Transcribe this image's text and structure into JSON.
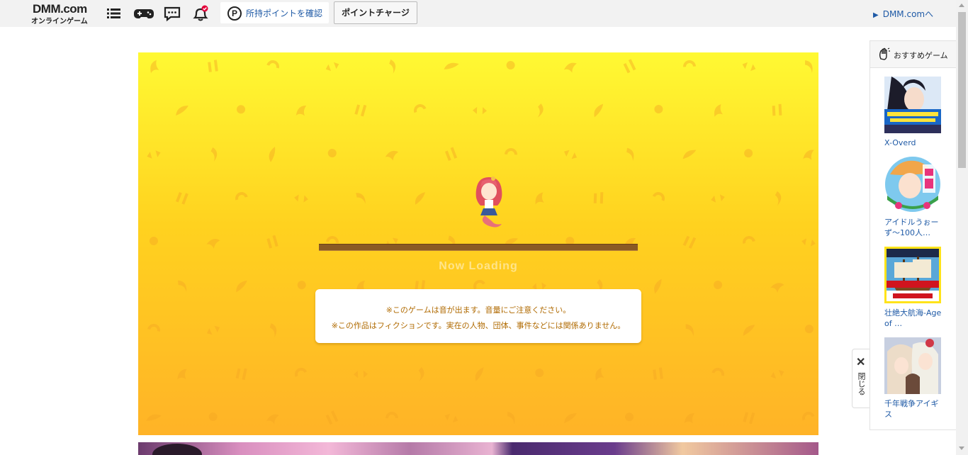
{
  "header": {
    "logo_main": "DMM.com",
    "logo_sub": "オンラインゲーム",
    "icons": [
      "list-icon",
      "gamepad-icon",
      "chat-icon",
      "bell-icon"
    ],
    "points_button": "所持ポイントを確認",
    "points_symbol": "P",
    "charge_button": "ポイントチャージ",
    "dmm_link": "DMM.comへ"
  },
  "game": {
    "loading_text": "Now Loading",
    "notice_line1": "※このゲームは音が出ます。音量にご注意ください。",
    "notice_line2": "※この作品はフィクションです。実在の人物、団体、事件などには関係ありません。",
    "progress": 0
  },
  "recommend": {
    "title": "おすすめゲーム",
    "items": [
      {
        "name": "X-Overd"
      },
      {
        "name": "アイドルうぉーず〜100人…"
      },
      {
        "name": "壮絶大航海-Age of …"
      },
      {
        "name": "千年戦争アイギス"
      }
    ],
    "close_label": "閉じる",
    "close_symbol": "✕"
  },
  "colors": {
    "link": "#1f5aa6",
    "bg_top": "#fff933",
    "bg_bottom": "#ffb327",
    "notice_text": "#b06a00"
  }
}
